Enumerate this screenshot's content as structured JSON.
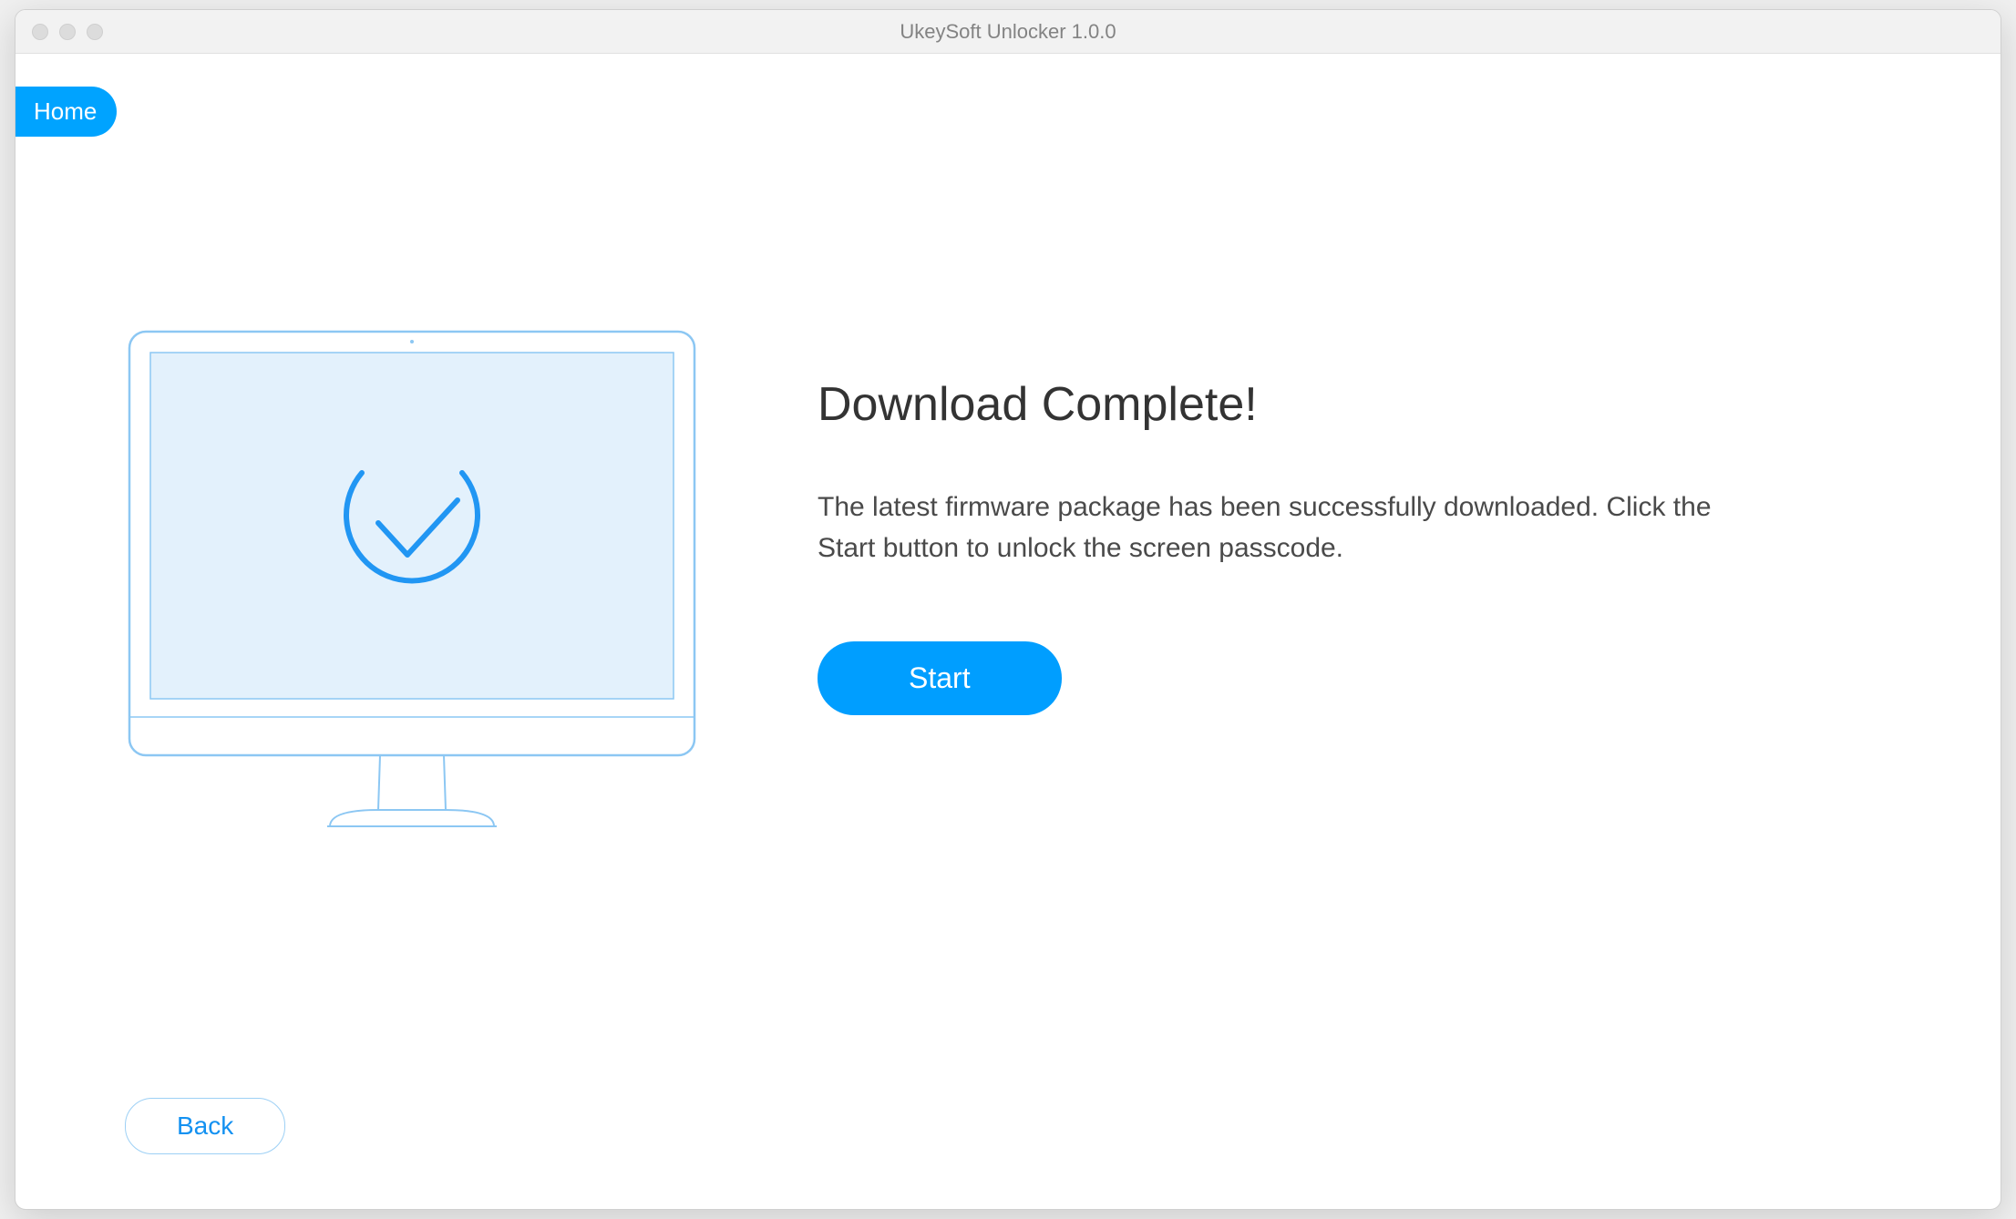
{
  "titlebar": {
    "title": "UkeySoft Unlocker 1.0.0"
  },
  "nav": {
    "home_label": "Home"
  },
  "main": {
    "heading": "Download Complete!",
    "description": "The latest firmware package has been successfully downloaded. Click the Start button to unlock the screen passcode.",
    "start_label": "Start"
  },
  "footer": {
    "back_label": "Back"
  },
  "colors": {
    "accent": "#009eff",
    "stroke_light": "#8cc7f3",
    "stroke_medium": "#2196f3",
    "screen_fill": "#e3f1fc"
  }
}
